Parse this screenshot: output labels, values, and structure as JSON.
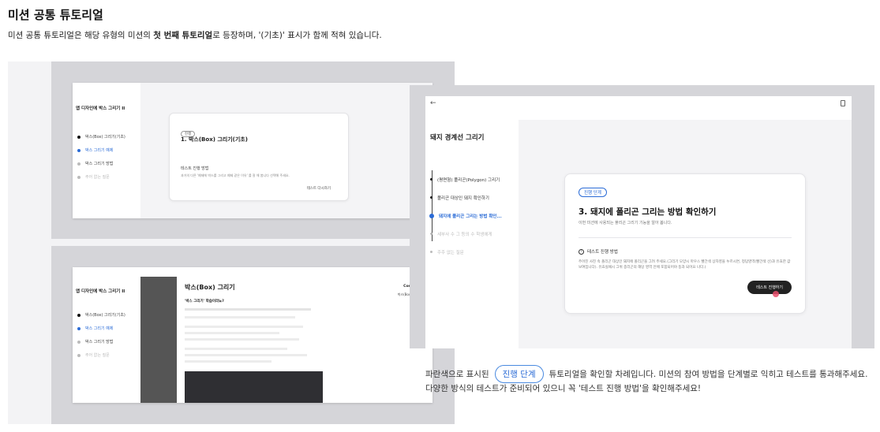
{
  "header": {
    "title": "미션 공통 튜토리얼",
    "subtitle_a": "미션 공통 튜토리얼은 해당 유형의 미션의 ",
    "subtitle_b": "첫 번째 튜토리얼",
    "subtitle_c": "로 등장하며, '(기초)' 표시가 함께 적혀 있습니다."
  },
  "shot1": {
    "side_title": "앱 디자인에 박스 그리기 II",
    "steps": [
      "박스(Box) 그리기(기초)",
      "박스 그리기 예제",
      "박스 그리기 방법",
      "주어 없는 질문"
    ],
    "card_pill": "진행",
    "card_title": "1. 박스(Box) 그리기(기초)",
    "card_test": "테스트 진행 방법",
    "card_desc": "과거의 다른 '예제에 박스를 그리고 예제 같은 이유' 를 잘 해 봅니다 선택해 주세요.",
    "card_link": "테스트 다시하기"
  },
  "shot2": {
    "side_title": "앱 디자인에 박스 그리기 II",
    "steps": [
      "박스(Box) 그리기(기초)",
      "박스 그리기 예제",
      "박스 그리기 방법",
      "주어 없는 질문"
    ],
    "doc_title": "박스(Box) 그리기",
    "doc_q": "'박스 그리기' 학습이라뇨?",
    "contents_label": "Contents",
    "contents_item": "박스(Box) 그리기"
  },
  "shot3": {
    "side_title": "돼지 경계선 그리기",
    "steps": [
      "(평면형) 폴리곤(Polygon) 그리기",
      "폴리곤 대상인 돼지 확인하기",
      "돼지에 폴리곤 그리는 방법 확인...",
      "세부사 수 그 등의 수 학생에게",
      "주주 없는 질문"
    ],
    "pill": "진행 단계",
    "card_title": "3. 돼지에 폴리곤 그리는 방법 확인하기",
    "card_sub": "이번 미션에 사용되는 폴리곤 그리기 기능을 알아 봅니다.",
    "test_label": "테스트 진행 방법",
    "test_desc": "주어진 사진 속 폴리곤 대상인 돼지에 폴리곤을 그려 주세요.(그리기 모양시 마우스 빨간색 상자영을 누르시면, 정답영역(빨간색 선)과 유효한 값 보여집니다). 유효실패시 그위 종리곤의 해당 영역 안에 포함되어야 등과 되어요 나다.)",
    "button": "테스트 진행하기"
  },
  "caption": {
    "line1_a": "파란색으로 표시된",
    "pill": "진행 단계",
    "line1_b": "튜토리얼을 확인할 차례입니다. 미션의 참여 방법을 단계별로 익히고 테스트를 통과해주세요.",
    "line2": "다양한 방식의 테스트가 준비되어 있으니 꼭 '테스트 진행 방법'을 확인해주세요!"
  },
  "colors": {
    "accent": "#2a6bd6",
    "button": "#222222",
    "frame": "#d5d5d9"
  }
}
